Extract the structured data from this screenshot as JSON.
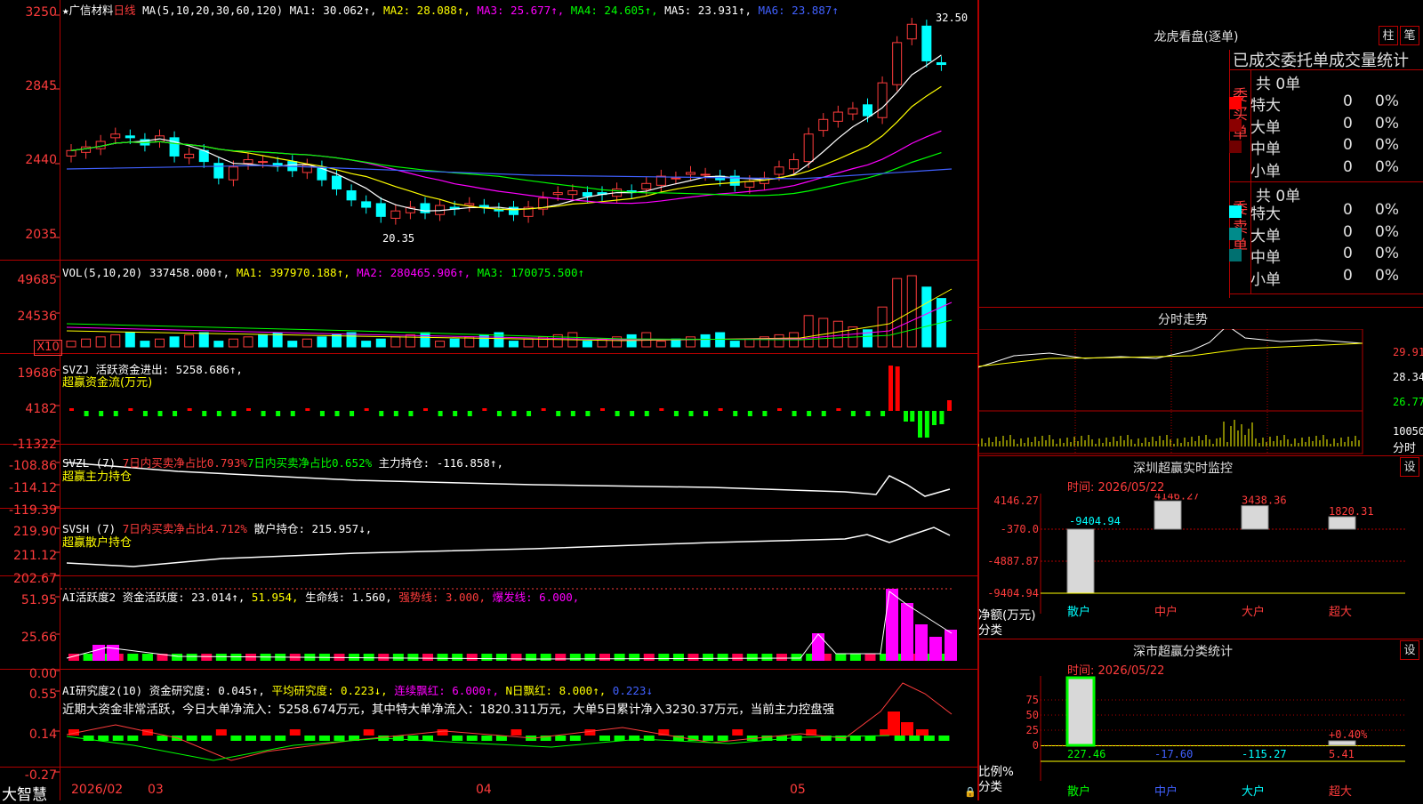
{
  "app_name": "大智慧",
  "stock": {
    "star": "★",
    "name": "广信材料",
    "period": "日线"
  },
  "price_pane": {
    "ma_header": "MA(5,10,20,30,60,120)",
    "ma1": "MA1: 30.062↑,",
    "ma2": "MA2: 28.088↑,",
    "ma3": "MA3: 25.677↑,",
    "ma4": "MA4: 24.605↑,",
    "ma5": "MA5: 23.931↑,",
    "ma6": "MA6: 23.887↑",
    "y_labels": [
      "3250",
      "2845",
      "2440",
      "2035"
    ],
    "high_label": "32.50",
    "low_label": "20.35"
  },
  "vol_pane": {
    "header": "VOL(5,10,20)",
    "value": "337458.000↑,",
    "ma1": "MA1: 397970.188↑,",
    "ma2": "MA2: 280465.906↑,",
    "ma3": "MA3: 170075.500↑",
    "y_labels": [
      "49685",
      "24536"
    ],
    "unit": "X10"
  },
  "svzj_pane": {
    "header": "SVZJ  活跃资金进出: 5258.686↑,",
    "sub": "超赢资金流(万元)",
    "y_labels": [
      "19686",
      "4182",
      "-11322"
    ]
  },
  "svzl_pane": {
    "h1": "SVZL (7)",
    "h2": "7日内买卖净占比0.793%",
    "h3": "7日内买卖净占比0.652%",
    "h4": "主力持仓: -116.858↑,",
    "sub": "超赢主力持仓",
    "y_labels": [
      "-108.86",
      "-114.12",
      "-119.39"
    ]
  },
  "svsh_pane": {
    "h1": "SVSH (7)",
    "h2": "7日内买卖净占比4.712%",
    "h3": "散户持仓: 215.957↓,",
    "sub": "超赢散户持仓",
    "y_labels": [
      "219.90",
      "211.12",
      "202.67"
    ]
  },
  "ai_pane": {
    "h1": "AI活跃度2 资金活跃度: 23.014↑,",
    "h2": "51.954,",
    "h3": "生命线: 1.560,",
    "h4": "强势线: 3.000,",
    "h5": "爆发线: 6.000,",
    "y_labels": [
      "51.95",
      "25.66",
      "0.00"
    ]
  },
  "ai2_pane": {
    "h1": "AI研究度2(10) 资金研究度: 0.045↑,",
    "h2": "平均研究度: 0.223↓,",
    "h3": "连续飘红: 6.000↑,",
    "h4": "N日飘红: 8.000↑,",
    "h5": "0.223↓",
    "note": "近期大资金非常活跃，今日大单净流入：5258.674万元，其中特大单净流入：1820.311万元，大单5日累计净入3230.37万元，当前主力控盘强",
    "y_labels": [
      "0.55",
      "0.14",
      "-0.27"
    ]
  },
  "x_axis": [
    "2026/02",
    "03",
    "04",
    "05"
  ],
  "side": {
    "lhb_title": "龙虎看盘(逐单)",
    "btn1": "柱",
    "btn2": "笔",
    "table_header": "已成交委托单成交量统计",
    "buy_label": "委买单",
    "sell_label": "委卖单",
    "buy_total": "共 0单",
    "sell_total": "共 0单",
    "buy_rows": [
      {
        "name": "特大",
        "n": "0",
        "p": "0%",
        "color": "#ff0000"
      },
      {
        "name": "大单",
        "n": "0",
        "p": "0%",
        "color": "#8b0000"
      },
      {
        "name": "中单",
        "n": "0",
        "p": "0%",
        "color": "#700000"
      },
      {
        "name": "小单",
        "n": "0",
        "p": "0%",
        "color": ""
      }
    ],
    "sell_rows": [
      {
        "name": "特大",
        "n": "0",
        "p": "0%",
        "color": "#00ffff"
      },
      {
        "name": "大单",
        "n": "0",
        "p": "0%",
        "color": "#008b8b"
      },
      {
        "name": "中单",
        "n": "0",
        "p": "0%",
        "color": "#007070"
      },
      {
        "name": "小单",
        "n": "0",
        "p": "0%",
        "color": ""
      }
    ],
    "fenshi_title": "分时走势",
    "fenshi_prices": [
      "29.91",
      "28.34",
      "26.77"
    ],
    "fenshi_vol": "10050",
    "fenshi_unit": "分时",
    "monitor_title": "深圳超赢实时监控",
    "monitor_btn": "设",
    "monitor_date": "时间: 2026/05/22",
    "monitor_y": [
      "4146.27",
      "-370.0",
      "-4887.87",
      "-9404.94"
    ],
    "monitor_bars": [
      {
        "cat": "散户",
        "value": -9404.94,
        "label": "-9404.94"
      },
      {
        "cat": "中户",
        "value": 4146.27,
        "label": "4146.27"
      },
      {
        "cat": "大户",
        "value": 3438.36,
        "label": "3438.36"
      },
      {
        "cat": "超大",
        "value": 1820.31,
        "label": "1820.31"
      }
    ],
    "monitor_axis1": "净额(万元)",
    "monitor_axis2": "分类",
    "class_title": "深市超赢分类统计",
    "class_btn": "设",
    "class_date": "时间: 2026/05/22",
    "class_y": [
      "75",
      "50",
      "25",
      "0"
    ],
    "class_bars": [
      {
        "cat": "散户",
        "value": 227.46,
        "label": "227.46",
        "pct": ""
      },
      {
        "cat": "中户",
        "value": -17.6,
        "label": "-17.60",
        "pct": ""
      },
      {
        "cat": "大户",
        "value": -115.27,
        "label": "-115.27",
        "pct": ""
      },
      {
        "cat": "超大",
        "value": 5.41,
        "label": "5.41",
        "pct": "+0.40%"
      }
    ],
    "class_axis1": "比例%",
    "class_axis2": "分类"
  }
}
